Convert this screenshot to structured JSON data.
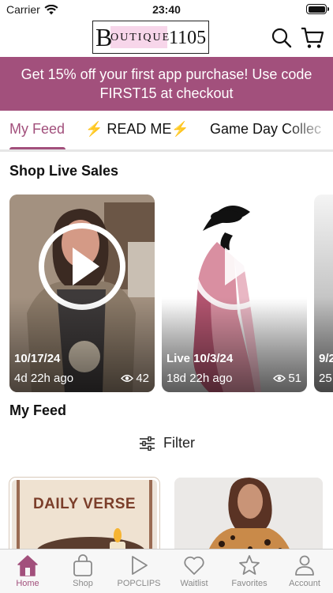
{
  "status_bar": {
    "carrier": "Carrier",
    "time": "23:40"
  },
  "header": {
    "logo": {
      "initial": "B",
      "word": "OUTIQUE",
      "number": "1105"
    }
  },
  "promo": {
    "line1": "Get 15% off your first app purchase!  Use code",
    "line2": "FIRST15 at checkout"
  },
  "tabs": [
    {
      "label": "My Feed",
      "active": true
    },
    {
      "label": "⚡ READ ME⚡",
      "active": false
    },
    {
      "label": "Game Day Collec",
      "active": false
    }
  ],
  "live": {
    "title": "Shop Live Sales",
    "cards": [
      {
        "date": "10/17/24",
        "ago": "4d 22h ago",
        "views": "42"
      },
      {
        "date": "Live 10/3/24",
        "ago": "18d 22h ago",
        "views": "51"
      },
      {
        "date": "9/2",
        "ago": "25"
      }
    ]
  },
  "feed": {
    "title": "My Feed",
    "filter_label": "Filter",
    "cards": [
      {
        "label": "DAILY VERSE"
      }
    ]
  },
  "tabbar": [
    {
      "label": "Home",
      "icon": "home-icon",
      "active": true
    },
    {
      "label": "Shop",
      "icon": "bag-icon",
      "active": false
    },
    {
      "label": "POPCLIPS",
      "icon": "play-icon",
      "active": false
    },
    {
      "label": "Waitlist",
      "icon": "heart-icon",
      "active": false
    },
    {
      "label": "Favorites",
      "icon": "star-icon",
      "active": false
    },
    {
      "label": "Account",
      "icon": "person-icon",
      "active": false
    }
  ],
  "colors": {
    "accent": "#a2507c",
    "logo_block": "#f7d6ea",
    "inactive": "#8a8a8a"
  }
}
